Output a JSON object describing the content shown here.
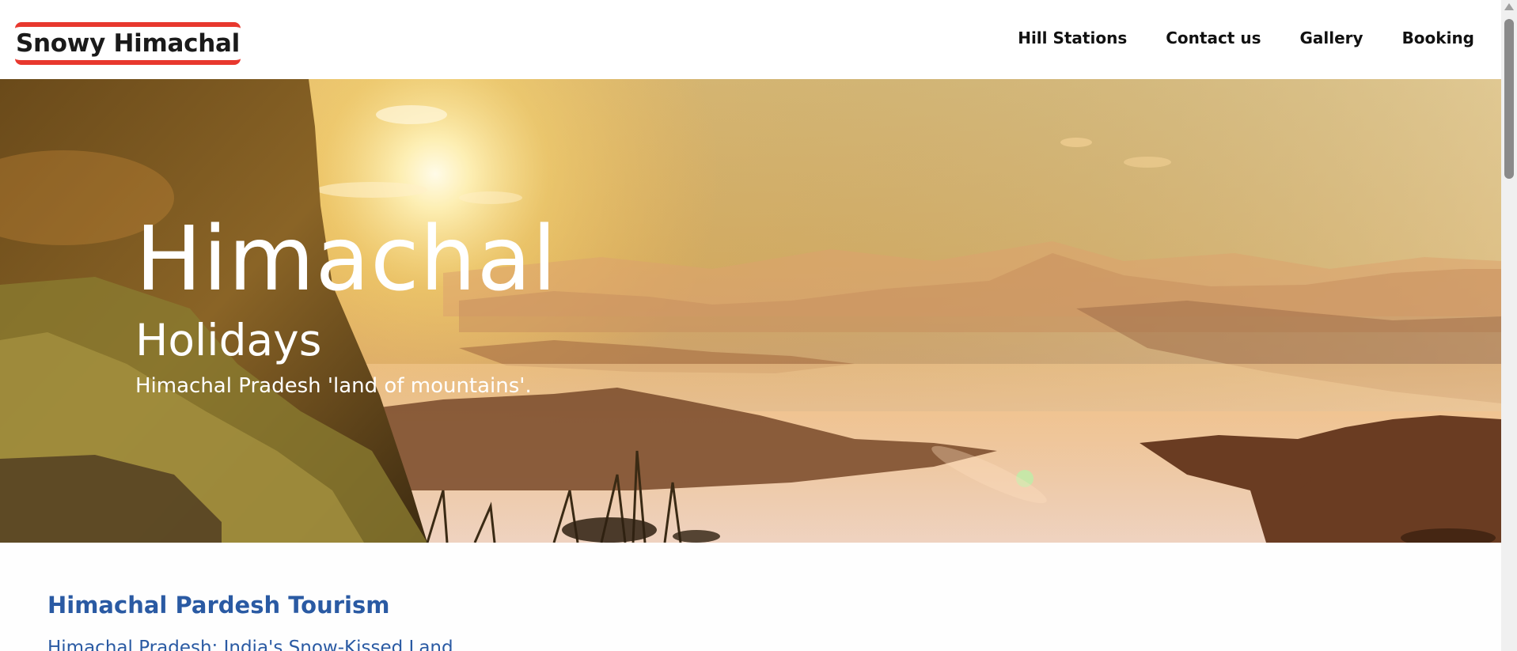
{
  "header": {
    "logo_text": "Snowy Himachal",
    "nav": [
      {
        "label": "Hill Stations"
      },
      {
        "label": "Contact us"
      },
      {
        "label": "Gallery"
      },
      {
        "label": "Booking"
      }
    ]
  },
  "hero": {
    "title": "Himachal",
    "subtitle": "Holidays",
    "tagline": "Himachal Pradesh 'land of mountains'."
  },
  "content": {
    "heading": "Himachal Pardesh Tourism",
    "link_text": "Himachal Pradesh: India's Snow-Kissed Land"
  },
  "colors": {
    "accent_red": "#e8382e",
    "heading_blue": "#2a5aa3"
  }
}
